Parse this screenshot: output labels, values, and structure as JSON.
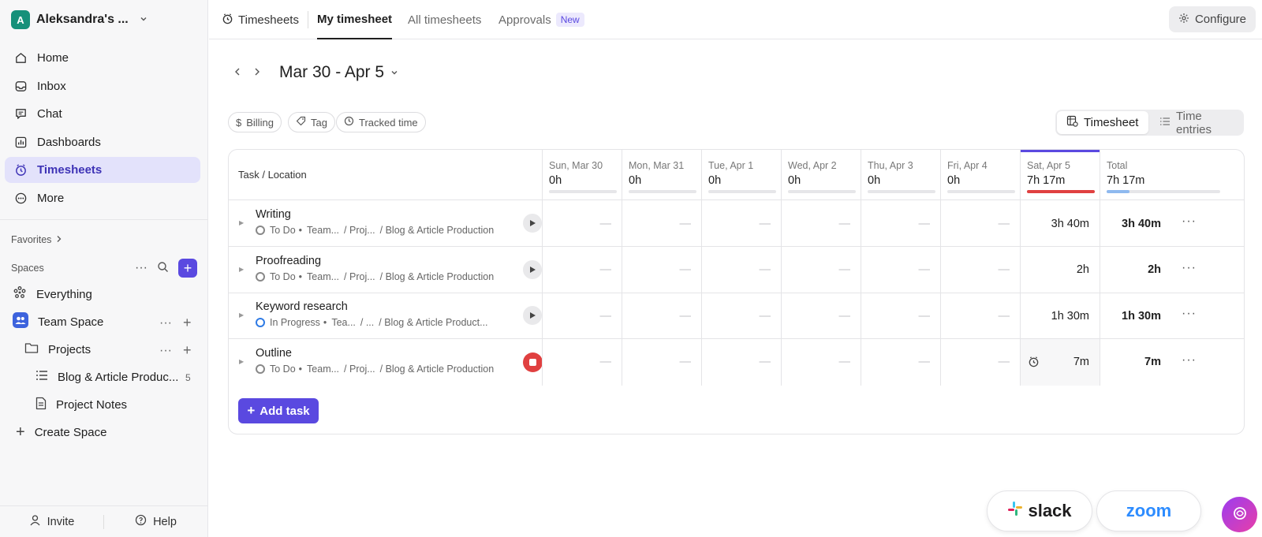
{
  "workspace": {
    "initial": "A",
    "name": "Aleksandra's ...",
    "chevron": "⌄"
  },
  "sidebar": {
    "nav": [
      {
        "label": "Home",
        "icon": "home-icon"
      },
      {
        "label": "Inbox",
        "icon": "inbox-icon"
      },
      {
        "label": "Chat",
        "icon": "chat-icon"
      },
      {
        "label": "Dashboards",
        "icon": "dashboards-icon"
      },
      {
        "label": "Timesheets",
        "icon": "timesheets-icon",
        "active": true
      },
      {
        "label": "More",
        "icon": "more-icon"
      }
    ],
    "favorites_label": "Favorites",
    "spaces_label": "Spaces",
    "tree": {
      "everything": "Everything",
      "team_space": "Team Space",
      "projects": "Projects",
      "blog": "Blog & Article Produc...",
      "blog_count": "5",
      "notes": "Project Notes",
      "create_space": "Create Space"
    },
    "invite": "Invite",
    "help": "Help"
  },
  "topbar": {
    "timesheets": "Timesheets",
    "my_timesheet": "My timesheet",
    "all_timesheets": "All timesheets",
    "approvals": "Approvals",
    "new_badge": "New",
    "configure": "Configure"
  },
  "date_range": "Mar 30 - Apr 5",
  "filters": {
    "billing": "Billing",
    "tag": "Tag",
    "tracked": "Tracked time"
  },
  "view_toggle": {
    "timesheet": "Timesheet",
    "time_entries": "Time entries"
  },
  "table": {
    "task_header": "Task / Location",
    "days": [
      {
        "name": "Sun, Mar 30",
        "hours": "0h",
        "fill": 0
      },
      {
        "name": "Mon, Mar 31",
        "hours": "0h",
        "fill": 0
      },
      {
        "name": "Tue, Apr 1",
        "hours": "0h",
        "fill": 0
      },
      {
        "name": "Wed, Apr 2",
        "hours": "0h",
        "fill": 0
      },
      {
        "name": "Thu, Apr 3",
        "hours": "0h",
        "fill": 0
      },
      {
        "name": "Fri, Apr 4",
        "hours": "0h",
        "fill": 0
      },
      {
        "name": "Sat, Apr 5",
        "hours": "7h 17m",
        "fill": 1,
        "today": true
      }
    ],
    "total": {
      "name": "Total",
      "hours": "7h 17m",
      "fill": 0.2
    },
    "empty_cell": "—",
    "rows": [
      {
        "name": "Writing",
        "status": "To Do",
        "space": "Team...",
        "folder": "/ Proj...",
        "list": "/ Blog & Article Production",
        "sat": "3h 40m",
        "total": "3h 40m",
        "running": false
      },
      {
        "name": "Proofreading",
        "status": "To Do",
        "space": "Team...",
        "folder": "/ Proj...",
        "list": "/ Blog & Article Production",
        "sat": "2h",
        "total": "2h",
        "running": false
      },
      {
        "name": "Keyword research",
        "status": "In Progress",
        "space": "Tea...",
        "folder": "/ ...",
        "list": "/ Blog & Article Product...",
        "sat": "1h 30m",
        "total": "1h 30m",
        "running": false
      },
      {
        "name": "Outline",
        "status": "To Do",
        "space": "Team...",
        "folder": "/ Proj...",
        "list": "/ Blog & Article Production",
        "sat": "7m",
        "total": "7m",
        "running": true
      }
    ],
    "row_menu": "···",
    "add_task": "Add task"
  },
  "integrations": {
    "slack": "slack",
    "zoom": "zoom"
  },
  "colors": {
    "accent": "#5a49e0",
    "today_bar": "#e04040",
    "total_bar": "#8fb9ef",
    "stop": "#e04040"
  }
}
